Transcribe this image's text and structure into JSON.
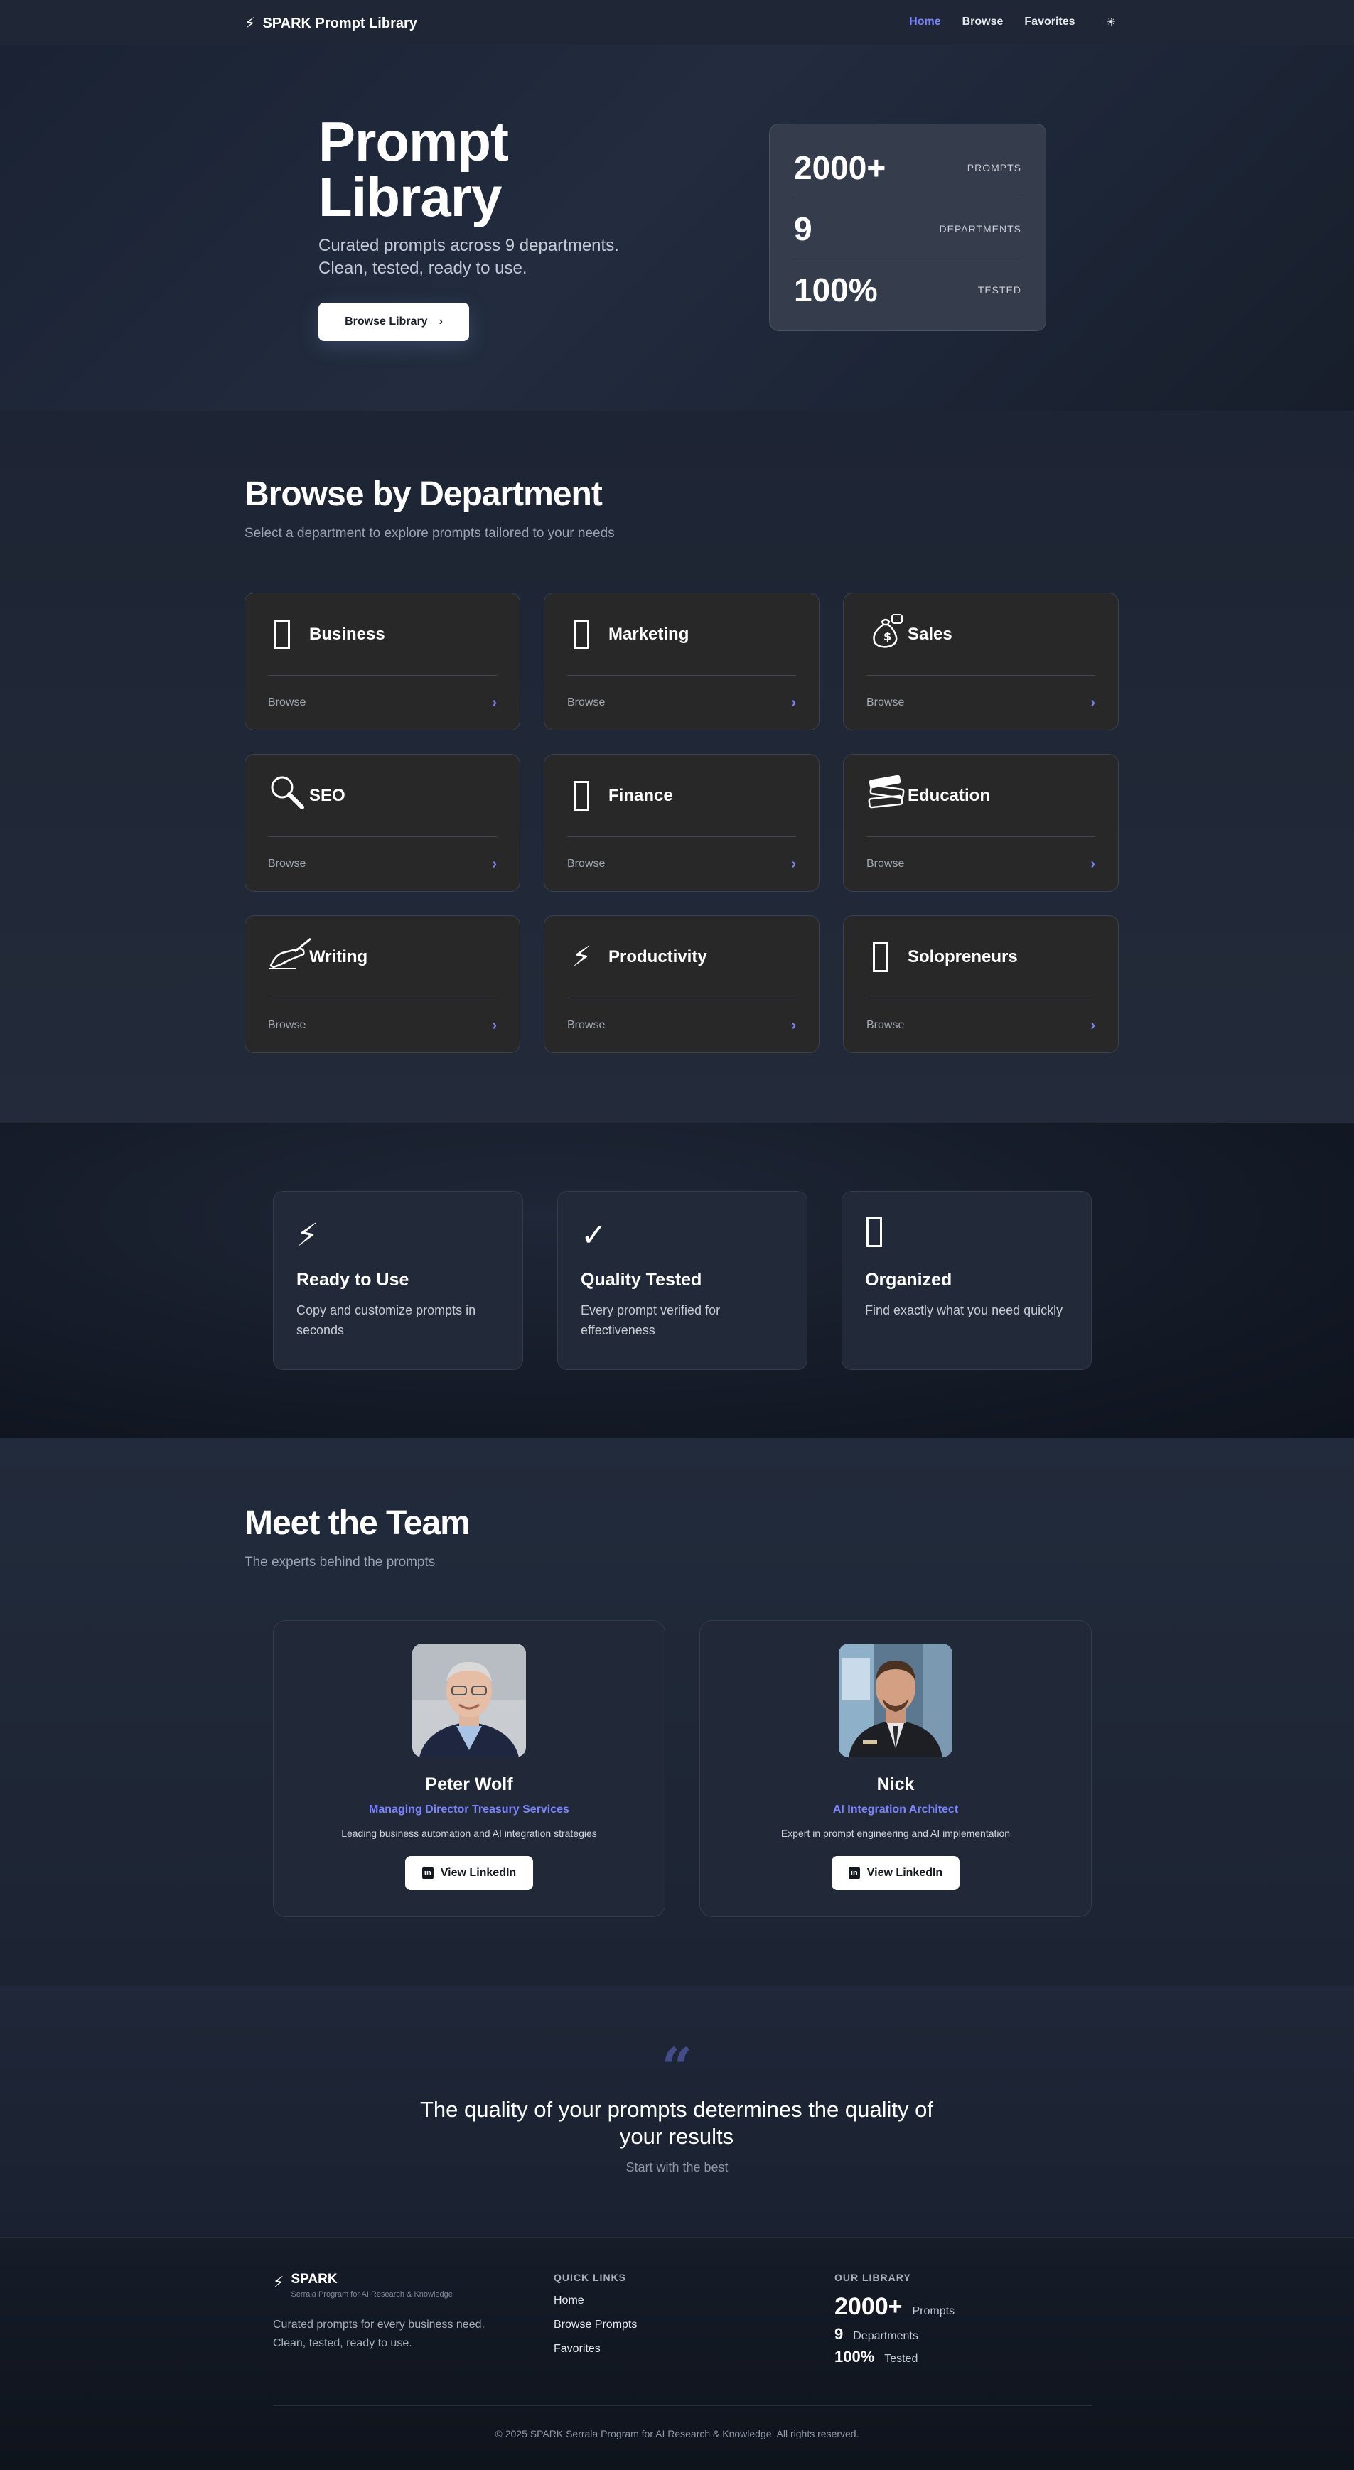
{
  "nav": {
    "brand": "SPARK Prompt Library",
    "brand_icon": "lightning-icon",
    "links": [
      "Home",
      "Browse",
      "Favorites"
    ],
    "theme_toggle": "☀",
    "active_color": "#7b83ff"
  },
  "hero": {
    "title": "Prompt Library",
    "subtitle_line1": "Curated prompts across 9 departments.",
    "subtitle_line2": "Clean, tested, ready to use.",
    "button": "Browse Library",
    "stats": [
      {
        "value": "2000+",
        "label": "PROMPTS"
      },
      {
        "value": "9",
        "label": "DEPARTMENTS"
      },
      {
        "value": "100%",
        "label": "TESTED"
      }
    ]
  },
  "departments": {
    "title": "Browse by Department",
    "subtitle": "Select a department to explore prompts tailored to your needs",
    "browse_label": "Browse",
    "items": [
      {
        "name": "Business",
        "icon": "briefcase-icon"
      },
      {
        "name": "Marketing",
        "icon": "megaphone-icon"
      },
      {
        "name": "Sales",
        "icon": "money-bag-icon"
      },
      {
        "name": "SEO",
        "icon": "magnifier-icon"
      },
      {
        "name": "Finance",
        "icon": "chart-icon"
      },
      {
        "name": "Education",
        "icon": "books-icon"
      },
      {
        "name": "Writing",
        "icon": "writing-hand-icon"
      },
      {
        "name": "Productivity",
        "icon": "lightning-icon"
      },
      {
        "name": "Solopreneurs",
        "icon": "person-icon"
      }
    ]
  },
  "features": [
    {
      "icon": "lightning-icon",
      "title": "Ready to Use",
      "desc": "Copy and customize prompts in seconds"
    },
    {
      "icon": "check-icon",
      "title": "Quality Tested",
      "desc": "Every prompt verified for effectiveness"
    },
    {
      "icon": "folder-icon",
      "title": "Organized",
      "desc": "Find exactly what you need quickly"
    }
  ],
  "team": {
    "title": "Meet the Team",
    "subtitle": "The experts behind the prompts",
    "members": [
      {
        "name": "Peter Wolf",
        "role": "Managing Director Treasury Services",
        "desc": "Leading business automation and AI integration strategies",
        "button": "View LinkedIn"
      },
      {
        "name": "Nick",
        "role": "AI Integration Architect",
        "desc": "Expert in prompt engineering and AI implementation",
        "button": "View LinkedIn"
      }
    ]
  },
  "quote": {
    "mark": "“",
    "text": "The quality of your prompts determines the quality of your results",
    "sub": "Start with the best"
  },
  "footer": {
    "brand": "SPARK",
    "tagline": "Serrala Program for AI Research & Knowledge",
    "desc_line1": "Curated prompts for every business need.",
    "desc_line2": "Clean, tested, ready to use.",
    "quick_links_title": "QUICK LINKS",
    "quick_links": [
      "Home",
      "Browse Prompts",
      "Favorites"
    ],
    "library_title": "OUR LIBRARY",
    "library_stats": [
      {
        "value": "2000+",
        "label": "Prompts"
      },
      {
        "value": "9",
        "label": "Departments"
      },
      {
        "value": "100%",
        "label": "Tested"
      }
    ],
    "copyright": "© 2025 SPARK Serrala Program for AI Research & Knowledge. All rights reserved."
  }
}
